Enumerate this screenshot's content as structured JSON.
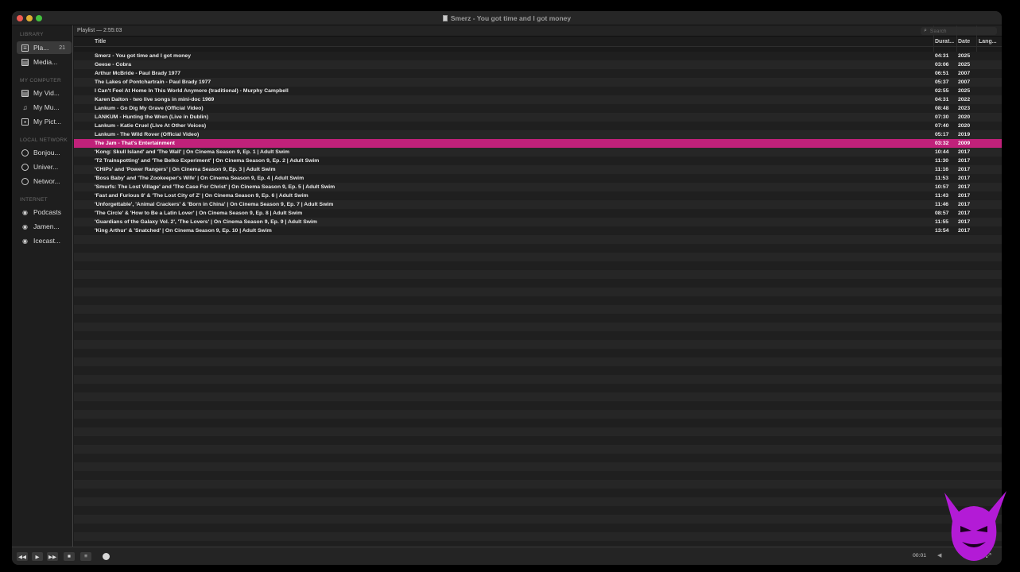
{
  "window": {
    "title": "Smerz - You got time and I got money"
  },
  "sidebar": {
    "sections": [
      {
        "heading": "LIBRARY",
        "items": [
          {
            "label": "Pla...",
            "count": "21",
            "icon": "playlist-icon",
            "selected": true
          },
          {
            "label": "Media...",
            "icon": "media-library-icon"
          }
        ]
      },
      {
        "heading": "MY COMPUTER",
        "items": [
          {
            "label": "My Vid...",
            "icon": "video-icon"
          },
          {
            "label": "My Mu...",
            "icon": "music-note-icon"
          },
          {
            "label": "My Pict...",
            "icon": "picture-icon"
          }
        ]
      },
      {
        "heading": "LOCAL NETWORK",
        "items": [
          {
            "label": "Bonjou...",
            "icon": "globe-icon"
          },
          {
            "label": "Univer...",
            "icon": "globe-icon"
          },
          {
            "label": "Networ...",
            "icon": "globe-icon"
          }
        ]
      },
      {
        "heading": "INTERNET",
        "items": [
          {
            "label": "Podcasts",
            "icon": "podcast-icon"
          },
          {
            "label": "Jamen...",
            "icon": "podcast-icon"
          },
          {
            "label": "Icecast...",
            "icon": "podcast-icon"
          }
        ]
      }
    ]
  },
  "playlist": {
    "header": "Playlist — 2:55:03",
    "search_placeholder": "Search",
    "columns": {
      "title": "Title",
      "duration": "Durat...",
      "date": "Date",
      "language": "Lang..."
    },
    "playing_index": 10,
    "rows": [
      {
        "title": "Smerz - You got time and I got money",
        "duration": "04:31",
        "date": "2025"
      },
      {
        "title": "Geese - Cobra",
        "duration": "03:06",
        "date": "2025"
      },
      {
        "title": "Arthur McBride - Paul Brady 1977",
        "duration": "06:51",
        "date": "2007"
      },
      {
        "title": "The Lakes of Pontchartrain - Paul Brady  1977",
        "duration": "05:37",
        "date": "2007"
      },
      {
        "title": "I Can't Feel At Home In This World Anymore (traditional) - Murphy Campbell",
        "duration": "02:55",
        "date": "2025"
      },
      {
        "title": "Karen Dalton - two live songs in mini-doc 1969",
        "duration": "04:31",
        "date": "2022"
      },
      {
        "title": "Lankum - Go Dig My Grave (Official Video)",
        "duration": "08:48",
        "date": "2023"
      },
      {
        "title": "LANKUM - Hunting the Wren (Live in Dublin)",
        "duration": "07:30",
        "date": "2020"
      },
      {
        "title": "Lankum - Katie Cruel (Live At Other Voices)",
        "duration": "07:40",
        "date": "2020"
      },
      {
        "title": "Lankum - The Wild Rover (Official Video)",
        "duration": "05:17",
        "date": "2019"
      },
      {
        "title": "The Jam - That's Entertainment",
        "duration": "03:32",
        "date": "2009"
      },
      {
        "title": "'Kong: Skull Island' and 'The Wall' | On Cinema Season 9, Ep. 1 | Adult Swim",
        "duration": "10:44",
        "date": "2017"
      },
      {
        "title": "'T2 Trainspotting' and 'The Belko Experiment' | On Cinema Season 9, Ep. 2 | Adult Swim",
        "duration": "11:30",
        "date": "2017"
      },
      {
        "title": "'CHiPs' and 'Power Rangers' | On Cinema Season 9, Ep. 3 | Adult Swim",
        "duration": "11:16",
        "date": "2017"
      },
      {
        "title": "'Boss Baby' and 'The Zookeeper's Wife' | On Cinema Season 9, Ep. 4 | Adult Swim",
        "duration": "11:53",
        "date": "2017"
      },
      {
        "title": "'Smurfs: The Lost Village' and 'The Case For Christ' | On Cinema Season 9, Ep. 5 | Adult Swim",
        "duration": "10:57",
        "date": "2017"
      },
      {
        "title": "'Fast and Furious 8' & 'The Lost City of Z' | On Cinema Season 9, Ep. 6 | Adult Swim",
        "duration": "11:43",
        "date": "2017"
      },
      {
        "title": "'Unforgettable', 'Animal Crackers' & 'Born in China' | On Cinema Season 9, Ep. 7 | Adult Swim",
        "duration": "11:46",
        "date": "2017"
      },
      {
        "title": "'The Circle' & 'How to Be a Latin Lover' | On Cinema Season 9, Ep. 8 | Adult Swim",
        "duration": "08:57",
        "date": "2017"
      },
      {
        "title": "'Guardians of the Galaxy Vol. 2', 'The Lovers' | On Cinema Season 9, Ep. 9 | Adult Swim",
        "duration": "11:55",
        "date": "2017"
      },
      {
        "title": "'King Arthur' & 'Snatched' | On Cinema Season 9, Ep. 10 | Adult Swim",
        "duration": "13:54",
        "date": "2017"
      }
    ]
  },
  "controls": {
    "rewind_icon": "rewind-icon",
    "play_icon": "play-icon",
    "forward_icon": "fast-forward-icon",
    "stop_icon": "stop-icon",
    "playlist_icon": "playlist-toggle-icon",
    "elapsed": "00:01",
    "playback_progress": 0.0
  },
  "colors": {
    "accent": "#c0217a",
    "mascot": "#b31bd6"
  }
}
